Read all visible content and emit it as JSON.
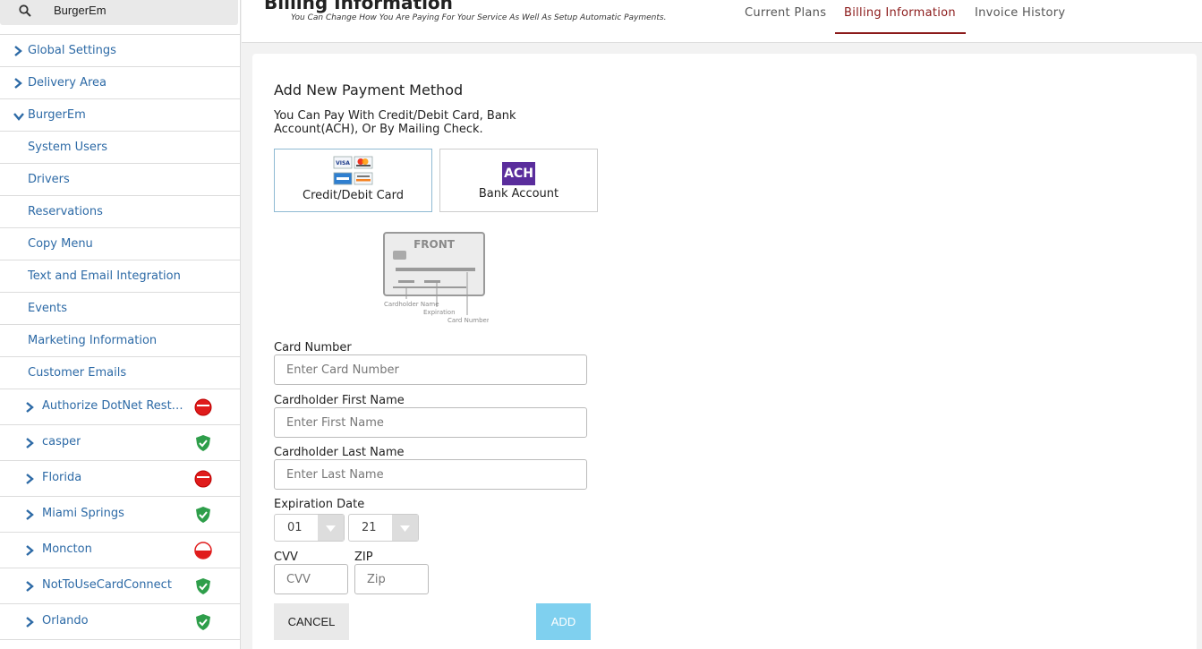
{
  "sidebar": {
    "search": {
      "value": "BurgerEm",
      "icon": "search-icon"
    },
    "items": [
      {
        "label": "Global Settings",
        "icon": "chevron-right-icon"
      },
      {
        "label": "Delivery Area",
        "icon": "chevron-right-icon"
      },
      {
        "label": "BurgerEm",
        "icon": "chevron-down-icon"
      },
      {
        "label": "System Users"
      },
      {
        "label": "Drivers"
      },
      {
        "label": "Reservations"
      },
      {
        "label": "Copy Menu"
      },
      {
        "label": "Text and Email Integration"
      },
      {
        "label": "Events"
      },
      {
        "label": "Marketing Information"
      },
      {
        "label": "Customer Emails"
      }
    ],
    "stores": [
      {
        "label": "Authorize DotNet Restaurants",
        "status": "inactive"
      },
      {
        "label": "casper",
        "status": "active"
      },
      {
        "label": "Florida",
        "status": "inactive"
      },
      {
        "label": "Miami Springs",
        "status": "active"
      },
      {
        "label": "Moncton",
        "status": "partial"
      },
      {
        "label": "NotToUseCardConnect",
        "status": "active"
      },
      {
        "label": "Orlando",
        "status": "active"
      }
    ]
  },
  "header": {
    "title": "Billing Information",
    "subtitle": "You Can Change How You Are Paying For Your Service As Well As Setup Automatic Payments.",
    "tabs": [
      {
        "label": "Current Plans",
        "active": false
      },
      {
        "label": "Billing Information",
        "active": true
      },
      {
        "label": "Invoice History",
        "active": false
      }
    ]
  },
  "form": {
    "heading": "Add New Payment Method",
    "description": "You Can Pay With Credit/Debit Card, Bank Account(ACH), Or By Mailing Check.",
    "methods": [
      {
        "label": "Credit/Debit Card",
        "selected": true,
        "logos": [
          "VISA",
          "MasterCard",
          "AMEX",
          "DISCOVER"
        ]
      },
      {
        "label": "Bank Account",
        "selected": false,
        "badge": "ACH"
      }
    ],
    "card_diagram": {
      "front": "FRONT",
      "cardholder": "Cardholder Name",
      "expiration": "Expiration",
      "card_number": "Card Number"
    },
    "card_number": {
      "label": "Card Number",
      "placeholder": "Enter Card Number"
    },
    "first_name": {
      "label": "Cardholder First Name",
      "placeholder": "Enter First Name"
    },
    "last_name": {
      "label": "Cardholder Last Name",
      "placeholder": "Enter Last Name"
    },
    "expiration": {
      "label": "Expiration Date",
      "month": "01",
      "year": "21"
    },
    "cvv": {
      "label": "CVV",
      "placeholder": "CVV"
    },
    "zip": {
      "label": "ZIP",
      "placeholder": "Zip"
    },
    "cancel_label": "CANCEL",
    "add_label": "ADD"
  },
  "colors": {
    "link": "#2d6aa6",
    "active_tab": "#8b1a1a",
    "status_active": "#2e9e4a",
    "status_inactive": "#e01b1b",
    "add_button": "#7fd0ef",
    "ach_badge": "#5a2d9c"
  }
}
